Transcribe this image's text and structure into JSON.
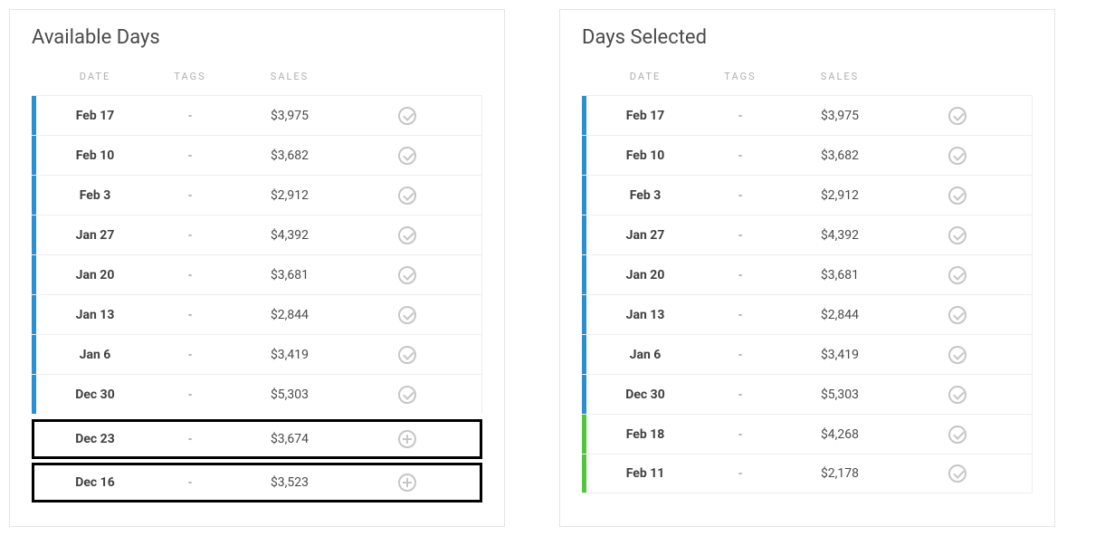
{
  "panels": {
    "available": {
      "title": "Available Days",
      "columns": {
        "date": "DATE",
        "tags": "TAGS",
        "sales": "SALES"
      },
      "rows": [
        {
          "date": "Feb 17",
          "tags": "-",
          "sales": "$3,975",
          "stripe": "blue",
          "action": "check",
          "highlighted": false
        },
        {
          "date": "Feb 10",
          "tags": "-",
          "sales": "$3,682",
          "stripe": "blue",
          "action": "check",
          "highlighted": false
        },
        {
          "date": "Feb 3",
          "tags": "-",
          "sales": "$2,912",
          "stripe": "blue",
          "action": "check",
          "highlighted": false
        },
        {
          "date": "Jan 27",
          "tags": "-",
          "sales": "$4,392",
          "stripe": "blue",
          "action": "check",
          "highlighted": false
        },
        {
          "date": "Jan 20",
          "tags": "-",
          "sales": "$3,681",
          "stripe": "blue",
          "action": "check",
          "highlighted": false
        },
        {
          "date": "Jan 13",
          "tags": "-",
          "sales": "$2,844",
          "stripe": "blue",
          "action": "check",
          "highlighted": false
        },
        {
          "date": "Jan 6",
          "tags": "-",
          "sales": "$3,419",
          "stripe": "blue",
          "action": "check",
          "highlighted": false
        },
        {
          "date": "Dec 30",
          "tags": "-",
          "sales": "$5,303",
          "stripe": "blue",
          "action": "check",
          "highlighted": false
        },
        {
          "date": "Dec 23",
          "tags": "-",
          "sales": "$3,674",
          "stripe": "none",
          "action": "plus",
          "highlighted": true
        },
        {
          "date": "Dec 16",
          "tags": "-",
          "sales": "$3,523",
          "stripe": "none",
          "action": "plus",
          "highlighted": true
        }
      ]
    },
    "selected": {
      "title": "Days Selected",
      "columns": {
        "date": "DATE",
        "tags": "TAGS",
        "sales": "SALES"
      },
      "rows": [
        {
          "date": "Feb 17",
          "tags": "-",
          "sales": "$3,975",
          "stripe": "blue",
          "action": "check",
          "highlighted": false
        },
        {
          "date": "Feb 10",
          "tags": "-",
          "sales": "$3,682",
          "stripe": "blue",
          "action": "check",
          "highlighted": false
        },
        {
          "date": "Feb 3",
          "tags": "-",
          "sales": "$2,912",
          "stripe": "blue",
          "action": "check",
          "highlighted": false
        },
        {
          "date": "Jan 27",
          "tags": "-",
          "sales": "$4,392",
          "stripe": "blue",
          "action": "check",
          "highlighted": false
        },
        {
          "date": "Jan 20",
          "tags": "-",
          "sales": "$3,681",
          "stripe": "blue",
          "action": "check",
          "highlighted": false
        },
        {
          "date": "Jan 13",
          "tags": "-",
          "sales": "$2,844",
          "stripe": "blue",
          "action": "check",
          "highlighted": false
        },
        {
          "date": "Jan 6",
          "tags": "-",
          "sales": "$3,419",
          "stripe": "blue",
          "action": "check",
          "highlighted": false
        },
        {
          "date": "Dec 30",
          "tags": "-",
          "sales": "$5,303",
          "stripe": "blue",
          "action": "check",
          "highlighted": false
        },
        {
          "date": "Feb 18",
          "tags": "-",
          "sales": "$4,268",
          "stripe": "green",
          "action": "check",
          "highlighted": false
        },
        {
          "date": "Feb 11",
          "tags": "-",
          "sales": "$2,178",
          "stripe": "green",
          "action": "check",
          "highlighted": false
        }
      ]
    }
  }
}
